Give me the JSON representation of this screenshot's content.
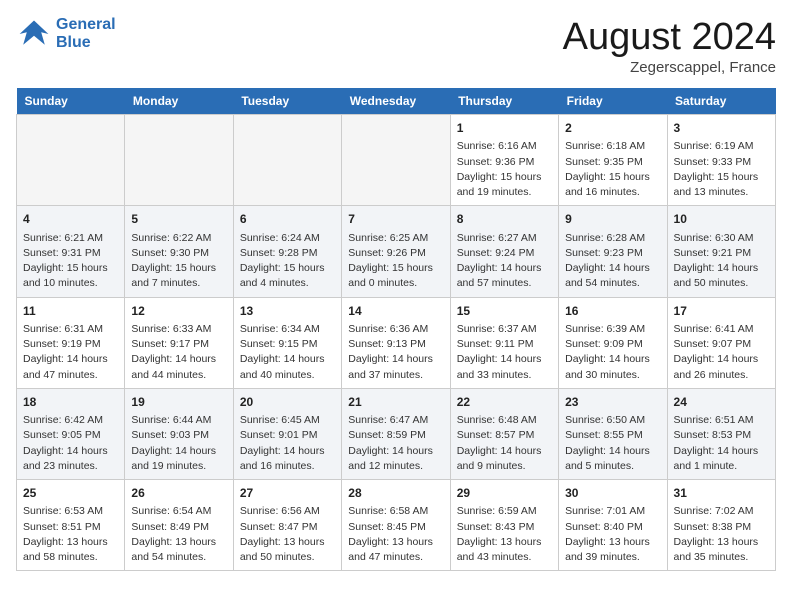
{
  "header": {
    "logo_line1": "General",
    "logo_line2": "Blue",
    "month": "August 2024",
    "location": "Zegerscappel, France"
  },
  "days_of_week": [
    "Sunday",
    "Monday",
    "Tuesday",
    "Wednesday",
    "Thursday",
    "Friday",
    "Saturday"
  ],
  "weeks": [
    [
      {
        "num": "",
        "info": ""
      },
      {
        "num": "",
        "info": ""
      },
      {
        "num": "",
        "info": ""
      },
      {
        "num": "",
        "info": ""
      },
      {
        "num": "1",
        "info": "Sunrise: 6:16 AM\nSunset: 9:36 PM\nDaylight: 15 hours\nand 19 minutes."
      },
      {
        "num": "2",
        "info": "Sunrise: 6:18 AM\nSunset: 9:35 PM\nDaylight: 15 hours\nand 16 minutes."
      },
      {
        "num": "3",
        "info": "Sunrise: 6:19 AM\nSunset: 9:33 PM\nDaylight: 15 hours\nand 13 minutes."
      }
    ],
    [
      {
        "num": "4",
        "info": "Sunrise: 6:21 AM\nSunset: 9:31 PM\nDaylight: 15 hours\nand 10 minutes."
      },
      {
        "num": "5",
        "info": "Sunrise: 6:22 AM\nSunset: 9:30 PM\nDaylight: 15 hours\nand 7 minutes."
      },
      {
        "num": "6",
        "info": "Sunrise: 6:24 AM\nSunset: 9:28 PM\nDaylight: 15 hours\nand 4 minutes."
      },
      {
        "num": "7",
        "info": "Sunrise: 6:25 AM\nSunset: 9:26 PM\nDaylight: 15 hours\nand 0 minutes."
      },
      {
        "num": "8",
        "info": "Sunrise: 6:27 AM\nSunset: 9:24 PM\nDaylight: 14 hours\nand 57 minutes."
      },
      {
        "num": "9",
        "info": "Sunrise: 6:28 AM\nSunset: 9:23 PM\nDaylight: 14 hours\nand 54 minutes."
      },
      {
        "num": "10",
        "info": "Sunrise: 6:30 AM\nSunset: 9:21 PM\nDaylight: 14 hours\nand 50 minutes."
      }
    ],
    [
      {
        "num": "11",
        "info": "Sunrise: 6:31 AM\nSunset: 9:19 PM\nDaylight: 14 hours\nand 47 minutes."
      },
      {
        "num": "12",
        "info": "Sunrise: 6:33 AM\nSunset: 9:17 PM\nDaylight: 14 hours\nand 44 minutes."
      },
      {
        "num": "13",
        "info": "Sunrise: 6:34 AM\nSunset: 9:15 PM\nDaylight: 14 hours\nand 40 minutes."
      },
      {
        "num": "14",
        "info": "Sunrise: 6:36 AM\nSunset: 9:13 PM\nDaylight: 14 hours\nand 37 minutes."
      },
      {
        "num": "15",
        "info": "Sunrise: 6:37 AM\nSunset: 9:11 PM\nDaylight: 14 hours\nand 33 minutes."
      },
      {
        "num": "16",
        "info": "Sunrise: 6:39 AM\nSunset: 9:09 PM\nDaylight: 14 hours\nand 30 minutes."
      },
      {
        "num": "17",
        "info": "Sunrise: 6:41 AM\nSunset: 9:07 PM\nDaylight: 14 hours\nand 26 minutes."
      }
    ],
    [
      {
        "num": "18",
        "info": "Sunrise: 6:42 AM\nSunset: 9:05 PM\nDaylight: 14 hours\nand 23 minutes."
      },
      {
        "num": "19",
        "info": "Sunrise: 6:44 AM\nSunset: 9:03 PM\nDaylight: 14 hours\nand 19 minutes."
      },
      {
        "num": "20",
        "info": "Sunrise: 6:45 AM\nSunset: 9:01 PM\nDaylight: 14 hours\nand 16 minutes."
      },
      {
        "num": "21",
        "info": "Sunrise: 6:47 AM\nSunset: 8:59 PM\nDaylight: 14 hours\nand 12 minutes."
      },
      {
        "num": "22",
        "info": "Sunrise: 6:48 AM\nSunset: 8:57 PM\nDaylight: 14 hours\nand 9 minutes."
      },
      {
        "num": "23",
        "info": "Sunrise: 6:50 AM\nSunset: 8:55 PM\nDaylight: 14 hours\nand 5 minutes."
      },
      {
        "num": "24",
        "info": "Sunrise: 6:51 AM\nSunset: 8:53 PM\nDaylight: 14 hours\nand 1 minute."
      }
    ],
    [
      {
        "num": "25",
        "info": "Sunrise: 6:53 AM\nSunset: 8:51 PM\nDaylight: 13 hours\nand 58 minutes."
      },
      {
        "num": "26",
        "info": "Sunrise: 6:54 AM\nSunset: 8:49 PM\nDaylight: 13 hours\nand 54 minutes."
      },
      {
        "num": "27",
        "info": "Sunrise: 6:56 AM\nSunset: 8:47 PM\nDaylight: 13 hours\nand 50 minutes."
      },
      {
        "num": "28",
        "info": "Sunrise: 6:58 AM\nSunset: 8:45 PM\nDaylight: 13 hours\nand 47 minutes."
      },
      {
        "num": "29",
        "info": "Sunrise: 6:59 AM\nSunset: 8:43 PM\nDaylight: 13 hours\nand 43 minutes."
      },
      {
        "num": "30",
        "info": "Sunrise: 7:01 AM\nSunset: 8:40 PM\nDaylight: 13 hours\nand 39 minutes."
      },
      {
        "num": "31",
        "info": "Sunrise: 7:02 AM\nSunset: 8:38 PM\nDaylight: 13 hours\nand 35 minutes."
      }
    ]
  ]
}
